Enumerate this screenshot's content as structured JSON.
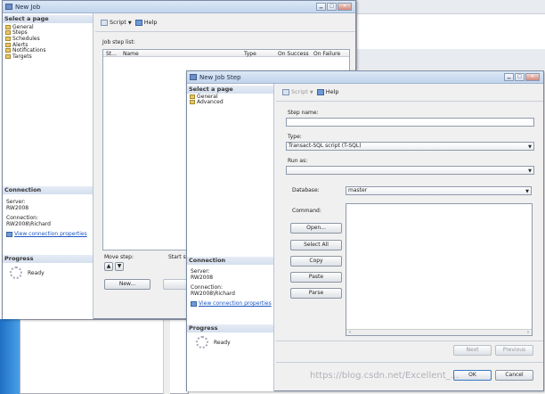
{
  "back_window": {
    "title": "New Job",
    "select_page_header": "Select a page",
    "pages": [
      "General",
      "Steps",
      "Schedules",
      "Alerts",
      "Notifications",
      "Targets"
    ],
    "toolbar": {
      "script": "Script",
      "help": "Help"
    },
    "job_step_list_label": "Job step list:",
    "columns": [
      "St...",
      "Name",
      "Type",
      "On Success",
      "On Failure"
    ],
    "connection_header": "Connection",
    "server_label": "Server:",
    "server_value": "RW2008",
    "connection_label": "Connection:",
    "connection_value": "RW2008\\Richard",
    "view_link": "View connection properties",
    "progress_header": "Progress",
    "progress_status": "Ready",
    "move_step_label": "Move step:",
    "start_step_label": "Start st",
    "new_button": "New..."
  },
  "front_window": {
    "title": "New Job Step",
    "select_page_header": "Select a page",
    "pages": [
      "General",
      "Advanced"
    ],
    "toolbar": {
      "script": "Script",
      "help": "Help"
    },
    "step_name_label": "Step name:",
    "step_name_value": "",
    "type_label": "Type:",
    "type_value": "Transact-SQL script (T-SQL)",
    "run_as_label": "Run as:",
    "run_as_value": "",
    "database_label": "Database:",
    "database_value": "master",
    "command_label": "Command:",
    "buttons": [
      "Open...",
      "Select All",
      "Copy",
      "Paste",
      "Parse"
    ],
    "connection_header": "Connection",
    "server_label": "Server:",
    "server_value": "RW2008",
    "connection_label": "Connection:",
    "connection_value": "RW2008\\Richard",
    "view_link": "View connection properties",
    "progress_header": "Progress",
    "progress_status": "Ready",
    "next_button": "Next",
    "previous_button": "Previous",
    "ok_button": "OK",
    "cancel_button": "Cancel"
  },
  "watermark": "https://blog.csdn.net/Excellent_..."
}
